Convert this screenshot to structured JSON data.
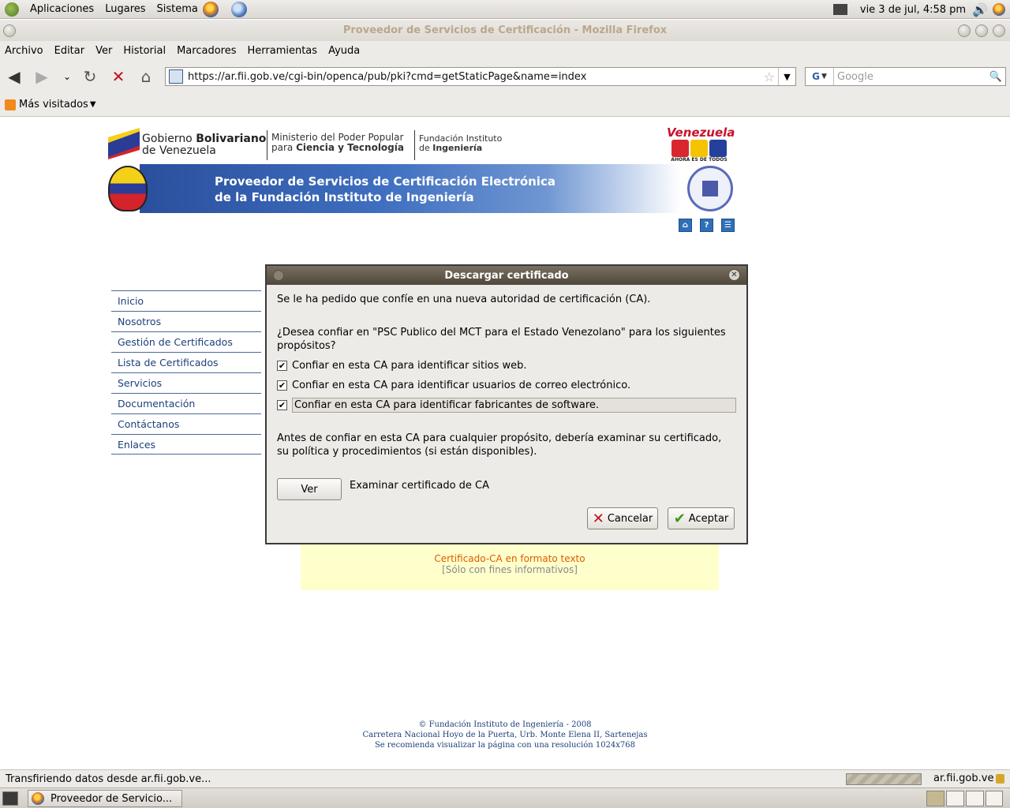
{
  "panel": {
    "menus": [
      "Aplicaciones",
      "Lugares",
      "Sistema"
    ],
    "clock": "vie  3 de jul,  4:58 pm"
  },
  "window": {
    "title": "Proveedor de Servicios de Certificación - Mozilla Firefox"
  },
  "menubar": [
    "Archivo",
    "Editar",
    "Ver",
    "Historial",
    "Marcadores",
    "Herramientas",
    "Ayuda"
  ],
  "navbar": {
    "url": "https://ar.fii.gob.ve/cgi-bin/openca/pub/pki?cmd=getStaticPage&name=index",
    "search_placeholder": "Google",
    "search_engine": "G"
  },
  "bookmarks": {
    "most_visited": "Más visitados"
  },
  "page": {
    "gob_line1_regular": "Gobierno ",
    "gob_line1_bold": "Bolivariano",
    "gob_line2": "de Venezuela",
    "ministry_line1": "Ministerio del Poder Popular",
    "ministry_line2_regular": "para ",
    "ministry_line2_bold": "Ciencia y Tecnología",
    "fii_line1": "Fundación Instituto",
    "fii_line2_regular": "de ",
    "fii_line2_bold": "Ingeniería",
    "venezuela_logo": "Venezuela",
    "venezuela_slogan": "AHORA ES DE TODOS",
    "banner_line1": "Proveedor de Servicios de Certificación Electrónica",
    "banner_line2": "de la Fundación Instituto de Ingeniería",
    "icons": [
      "home-icon",
      "help-icon",
      "sitemap-icon"
    ],
    "nav": [
      "Inicio",
      "Nosotros",
      "Gestión de Certificados",
      "Lista de Certificados",
      "Servicios",
      "Documentación",
      "Contáctanos",
      "Enlaces"
    ],
    "info_link": "Certificado-CA en formato texto",
    "info_note": "[Sólo con fines informativos]",
    "footer": [
      "© Fundación Instituto de Ingeniería - 2008",
      "Carretera Nacional Hoyo de la Puerta, Urb. Monte Elena II, Sartenejas",
      "Se recomienda visualizar la página con una resolución 1024x768"
    ]
  },
  "dialog": {
    "title": "Descargar certificado",
    "intro": "Se le ha pedido que confíe en una nueva autoridad de certificación (CA).",
    "question": "¿Desea confiar en \"PSC Publico del MCT para el Estado Venezolano\" para los siguientes propósitos?",
    "options": [
      {
        "label": "Confiar en esta CA para identificar sitios web.",
        "checked": true
      },
      {
        "label": "Confiar en esta CA para identificar usuarios de correo electrónico.",
        "checked": true
      },
      {
        "label": "Confiar en esta CA para identificar fabricantes de software.",
        "checked": true
      }
    ],
    "advice": "Antes de confiar en esta CA para cualquier propósito, debería examinar su certificado, su política y procedimientos (si están disponibles).",
    "view_button": "Ver",
    "view_caption": "Examinar certificado de CA",
    "cancel_button": "Cancelar",
    "accept_button": "Aceptar"
  },
  "statusbar": {
    "text": "Transfiriendo datos desde ar.fii.gob.ve...",
    "domain": "ar.fii.gob.ve"
  },
  "taskbar": {
    "task": "Proveedor de Servicio..."
  }
}
